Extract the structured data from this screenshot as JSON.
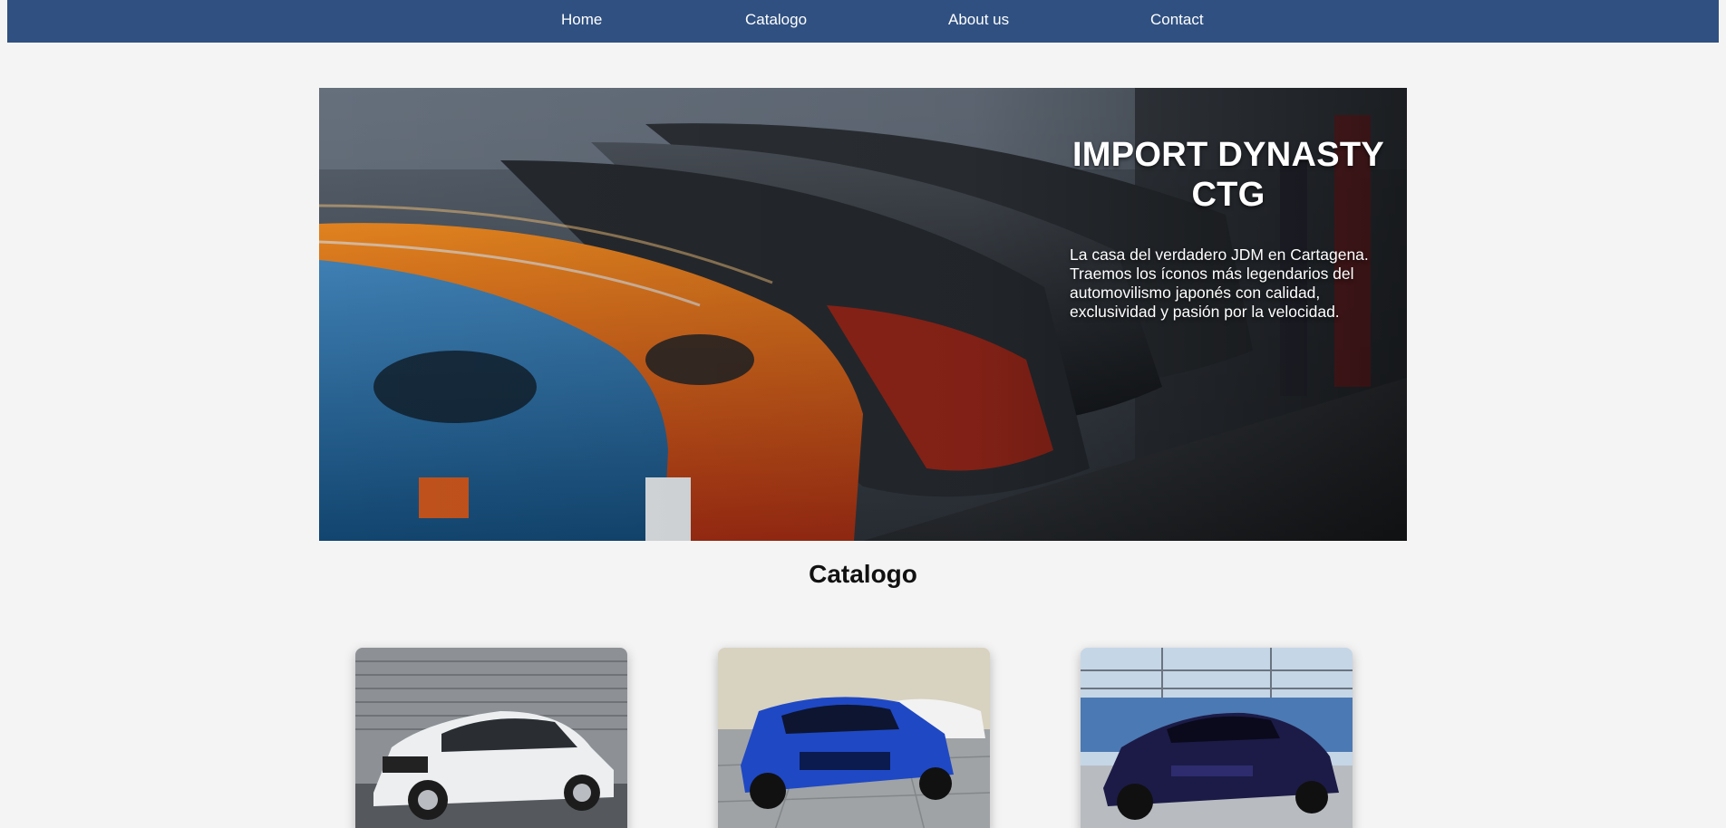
{
  "nav": {
    "items": [
      {
        "label": "Home"
      },
      {
        "label": "Catalogo"
      },
      {
        "label": "About us"
      },
      {
        "label": "Contact"
      }
    ],
    "background": "#2f5081"
  },
  "hero": {
    "title": "IMPORT DYNASTY CTG",
    "description": "La casa del verdadero JDM en Cartagena. Traemos los íconos más legendarios del automovilismo japonés con calidad, exclusividad y pasión por la velocidad."
  },
  "catalog": {
    "title": "Catalogo",
    "cards": [
      {
        "image": "white-sedan-photo"
      },
      {
        "image": "blue-coupe-photo"
      },
      {
        "image": "purple-sports-car-photo"
      }
    ]
  }
}
